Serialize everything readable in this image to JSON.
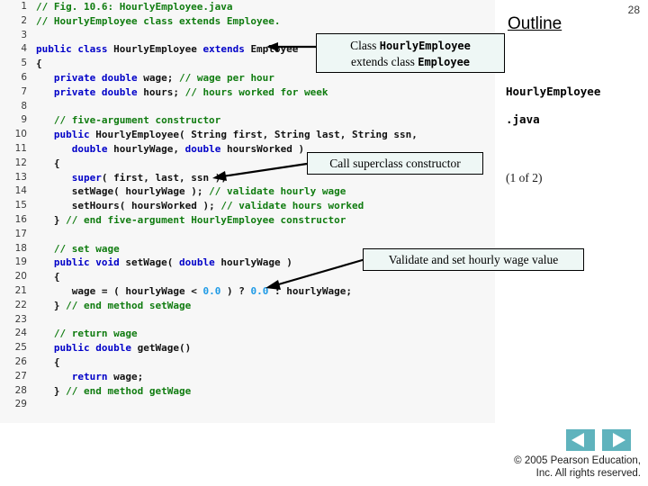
{
  "page": {
    "number": "28",
    "background": "#ffffff"
  },
  "code_panel": {
    "background": "#f7f7f7",
    "colors": {
      "comment": "#107c10",
      "keyword": "#0000c8",
      "number": "#1e9ae6",
      "plain": "#111111",
      "line_number": "#3b3b3b"
    },
    "lines": [
      {
        "n": "1",
        "html": "<span class='c-cmt'>// Fig. 10.6: HourlyEmployee.java</span>"
      },
      {
        "n": "2",
        "html": "<span class='c-cmt'>// HourlyEmployee class extends Employee.</span>"
      },
      {
        "n": "3",
        "html": ""
      },
      {
        "n": "4",
        "html": "<span class='c-kw'>public class</span> <span class='c-pln'>HourlyEmployee</span> <span class='c-kw'>extends</span> <span class='c-pln'>Employee</span>"
      },
      {
        "n": "5",
        "html": "<span class='c-pln'>{</span>"
      },
      {
        "n": "6",
        "html": "   <span class='c-kw'>private double</span> <span class='c-pln'>wage;</span> <span class='c-cmt'>// wage per hour</span>"
      },
      {
        "n": "7",
        "html": "   <span class='c-kw'>private double</span> <span class='c-pln'>hours;</span> <span class='c-cmt'>// hours worked for week</span>"
      },
      {
        "n": "8",
        "html": ""
      },
      {
        "n": "9",
        "html": "   <span class='c-cmt'>// five-argument constructor</span>"
      },
      {
        "n": "10",
        "html": "   <span class='c-kw'>public</span> <span class='c-pln'>HourlyEmployee( String first, String last, String ssn,</span>"
      },
      {
        "n": "11",
        "html": "      <span class='c-kw'>double</span> <span class='c-pln'>hourlyWage,</span> <span class='c-kw'>double</span> <span class='c-pln'>hoursWorked )</span>"
      },
      {
        "n": "12",
        "html": "   <span class='c-pln'>{</span>"
      },
      {
        "n": "13",
        "html": "      <span class='c-kw'>super</span><span class='c-pln'>( first, last, ssn );</span>"
      },
      {
        "n": "14",
        "html": "      <span class='c-pln'>setWage( hourlyWage );</span> <span class='c-cmt'>// validate hourly wage</span>"
      },
      {
        "n": "15",
        "html": "      <span class='c-pln'>setHours( hoursWorked );</span> <span class='c-cmt'>// validate hours worked</span>"
      },
      {
        "n": "16",
        "html": "   <span class='c-pln'>}</span> <span class='c-cmt'>// end five-argument HourlyEmployee constructor</span>"
      },
      {
        "n": "17",
        "html": ""
      },
      {
        "n": "18",
        "html": "   <span class='c-cmt'>// set wage</span>"
      },
      {
        "n": "19",
        "html": "   <span class='c-kw'>public void</span> <span class='c-pln'>setWage(</span> <span class='c-kw'>double</span> <span class='c-pln'>hourlyWage )</span>"
      },
      {
        "n": "20",
        "html": "   <span class='c-pln'>{</span>"
      },
      {
        "n": "21",
        "html": "      <span class='c-pln'>wage = ( hourlyWage &lt;</span> <span class='c-num'>0.0</span> <span class='c-pln'>) ?</span> <span class='c-num'>0.0</span> <span class='c-pln'>: hourlyWage;</span>"
      },
      {
        "n": "22",
        "html": "   <span class='c-pln'>}</span> <span class='c-cmt'>// end method setWage</span>"
      },
      {
        "n": "23",
        "html": ""
      },
      {
        "n": "24",
        "html": "   <span class='c-cmt'>// return wage</span>"
      },
      {
        "n": "25",
        "html": "   <span class='c-kw'>public double</span> <span class='c-pln'>getWage()</span>"
      },
      {
        "n": "26",
        "html": "   <span class='c-pln'>{</span>"
      },
      {
        "n": "27",
        "html": "      <span class='c-kw'>return</span> <span class='c-pln'>wage;</span>"
      },
      {
        "n": "28",
        "html": "   <span class='c-pln'>}</span> <span class='c-cmt'>// end method getWage</span>"
      },
      {
        "n": "29",
        "html": ""
      }
    ]
  },
  "callouts": {
    "class_extends": {
      "line1_prefix": "Class ",
      "line1_mono": "HourlyEmployee",
      "line2_prefix": "extends class ",
      "line2_mono": "Employee"
    },
    "super_constructor": "Call superclass constructor",
    "validate_wage": "Validate and set hourly wage value"
  },
  "outline": {
    "title": "Outline",
    "filename_line1": "HourlyEmployee",
    "filename_line2": ".java",
    "progress": "(1 of 2)"
  },
  "navigation": {
    "prev_label": "previous-slide",
    "next_label": "next-slide",
    "button_color": "#5fb3bd"
  },
  "footer": {
    "copyright_line1": "© 2005 Pearson Education,",
    "copyright_line2": "Inc.  All rights reserved."
  }
}
